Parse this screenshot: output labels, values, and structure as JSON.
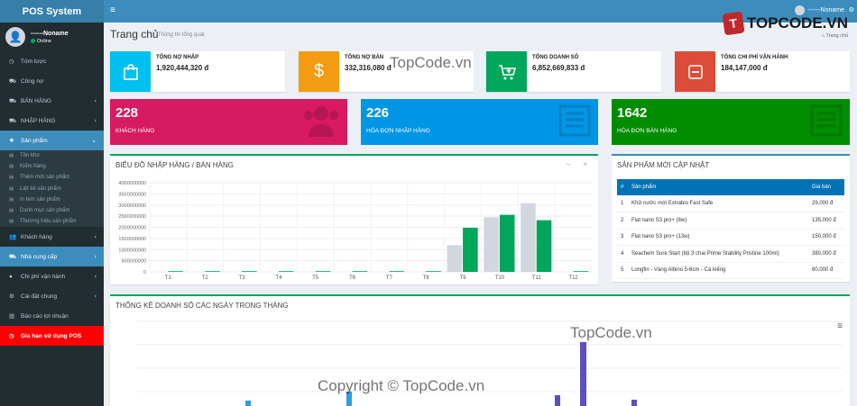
{
  "brand": "POS System",
  "user": {
    "name": "------Noname",
    "status": "Online"
  },
  "menu": [
    {
      "label": "Tóm lược",
      "icon": "dashboard-icon",
      "chev": ""
    },
    {
      "label": "Công nợ",
      "icon": "cart-icon",
      "chev": ""
    },
    {
      "label": "BÁN HÀNG",
      "icon": "cart-icon",
      "chev": "‹"
    },
    {
      "label": "NHẬP HÀNG",
      "icon": "cart-icon",
      "chev": "‹"
    },
    {
      "label": "Sản phẩm",
      "icon": "cubes-icon",
      "chev": "⌄"
    }
  ],
  "submenu": [
    "Tồn kho",
    "Kiểm hàng",
    "Thêm mới sản phẩm",
    "Liệt kê sản phẩm",
    "In tem sản phẩm",
    "Danh mục sản phẩm",
    "Thương hiệu sản phẩm"
  ],
  "menu2": [
    {
      "label": "Khách hàng",
      "icon": "users-icon",
      "chev": "‹"
    },
    {
      "label": "Nhà cung cấp",
      "icon": "truck-icon",
      "chev": "‹"
    },
    {
      "label": "Chi phí vận hành",
      "icon": "dollar-icon",
      "chev": "‹"
    },
    {
      "label": "Cài đặt chung",
      "icon": "cogs-icon",
      "chev": "‹"
    },
    {
      "label": "Báo cáo lợi nhuận",
      "icon": "chart-icon",
      "chev": ""
    },
    {
      "label": "Gia hạn sử dụng POS",
      "icon": "clock-icon",
      "chev": ""
    }
  ],
  "topbar": {
    "user": "------Noname"
  },
  "logo": {
    "mark": "T",
    "text": "TOPCODE.VN"
  },
  "page": {
    "title": "Trang chủ",
    "subtitle": "Thông tin tổng quát",
    "crumb": "⌂ Trang chủ"
  },
  "info_boxes": [
    {
      "label": "TỔNG NỢ NHẬP",
      "value": "1,920,444,320 đ",
      "color": "#00c0ef",
      "icon": "bag-icon",
      "glyph": "🛍"
    },
    {
      "label": "TỔNG NỢ BÁN",
      "value": "332,316,080 đ",
      "color": "#f39c12",
      "icon": "dollar-icon",
      "glyph": "$"
    },
    {
      "label": "TỔNG DOANH SỐ",
      "value": "6,852,669,833 đ",
      "color": "#00a65a",
      "icon": "cart-plus-icon",
      "glyph": "⊞"
    },
    {
      "label": "TỔNG CHI PHÍ VẬN HÀNH",
      "value": "184,147,000 đ",
      "color": "#dd4b39",
      "icon": "minus-square-icon",
      "glyph": "⊟"
    }
  ],
  "small_boxes": [
    {
      "num": "228",
      "label": "KHÁCH HÀNG",
      "color": "#d81b60"
    },
    {
      "num": "226",
      "label": "HÓA ĐƠN NHẬP HÀNG",
      "color": "#0096e6"
    },
    {
      "num": "1642",
      "label": "HÓA ĐƠN BÁN HÀNG",
      "color": "#008d00"
    }
  ],
  "chart_panel": {
    "title": "BIỂU ĐỒ NHẬP HÀNG / BÁN HÀNG",
    "tools": "− ×"
  },
  "chart_data": {
    "type": "bar",
    "categories": [
      "T1",
      "T2",
      "T3",
      "T4",
      "T5",
      "T6",
      "T7",
      "T8",
      "T9",
      "T10",
      "T11",
      "T12"
    ],
    "yticks": [
      "4000000000",
      "3500000000",
      "3000000000",
      "2500000000",
      "2000000000",
      "1500000000",
      "1000000000",
      "500000000",
      "0"
    ],
    "ylim": [
      0,
      4000000000
    ],
    "series": [
      {
        "values": [
          0,
          0,
          0,
          0,
          0,
          0,
          0,
          0,
          1200000000,
          2450000000,
          3080000000,
          0
        ],
        "color": "#d2d6de"
      },
      {
        "values": [
          20000000,
          20000000,
          20000000,
          20000000,
          20000000,
          20000000,
          20000000,
          20000000,
          1980000000,
          2560000000,
          2320000000,
          20000000
        ],
        "color": "#00a65a"
      }
    ]
  },
  "products_panel": {
    "title": "SẢN PHẨM MỚI CẬP NHẬT",
    "headers": [
      "#",
      "Sản phẩm",
      "Giá bán"
    ],
    "rows": [
      [
        "1",
        "Khử nước mới Extrabio Fast Safe",
        "29,000 đ"
      ],
      [
        "2",
        "Flat nano S3 pro+ (8w)",
        "135,000 đ"
      ],
      [
        "3",
        "Flat nano S3 pro+ (13w)",
        "150,000 đ"
      ],
      [
        "4",
        "Seachem Sure Start (bộ 3 chai Prime Stability Pristine 100ml)",
        "380,000 đ"
      ],
      [
        "5",
        "Longfin - Vàng Albino 5-6cm - Cá kiểng",
        "80,000 đ"
      ]
    ]
  },
  "daily_panel": {
    "title": "THỐNG KÊ DOANH SỐ CÁC NGÀY TRONG THÁNG"
  },
  "watermarks": {
    "a": "TopCode.vn",
    "b": "TopCode.vn",
    "c": "Copyright © TopCode.vn"
  }
}
